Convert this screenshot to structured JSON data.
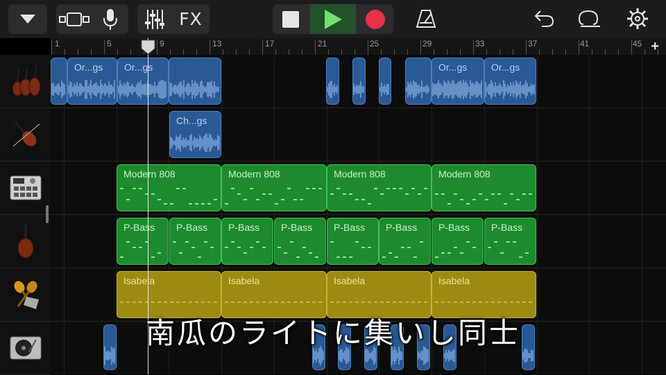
{
  "toolbar": {
    "fx_label": "FX"
  },
  "ruler": {
    "bars": [
      "1",
      "5",
      "9",
      "13",
      "17",
      "21",
      "25",
      "29",
      "33",
      "37",
      "41",
      "45"
    ]
  },
  "tracks": [
    {
      "icon": "string-ensemble-icon"
    },
    {
      "icon": "violin-icon"
    },
    {
      "icon": "drum-machine-icon"
    },
    {
      "icon": "cello-icon"
    },
    {
      "icon": "percussion-icon"
    },
    {
      "icon": "turntable-icon"
    }
  ],
  "regions": {
    "strings_1": "Or...gs",
    "strings_2": "Or...gs",
    "strings_3": "Or...gs",
    "strings_4": "Or...gs",
    "violin_1": "Ch...gs",
    "drums": [
      "Modern 808",
      "Modern 808",
      "Modern 808",
      "Modern 808"
    ],
    "bass": [
      "P-Bass",
      "P-Bass",
      "P-Bass",
      "P-Bass",
      "P-Bass",
      "P-Bass",
      "P-Bass",
      "P-Bass"
    ],
    "perc": [
      "Isabela",
      "Isabela",
      "Isabela",
      "Isabela"
    ]
  },
  "subtitle": "南瓜のライトに集いし同士",
  "colors": {
    "audio_region": "#2a5a95",
    "drummer_region": "#1e8a2e",
    "percussion_region": "#9c8b12",
    "play_active": "#6ee36e",
    "record": "#e8304a"
  }
}
